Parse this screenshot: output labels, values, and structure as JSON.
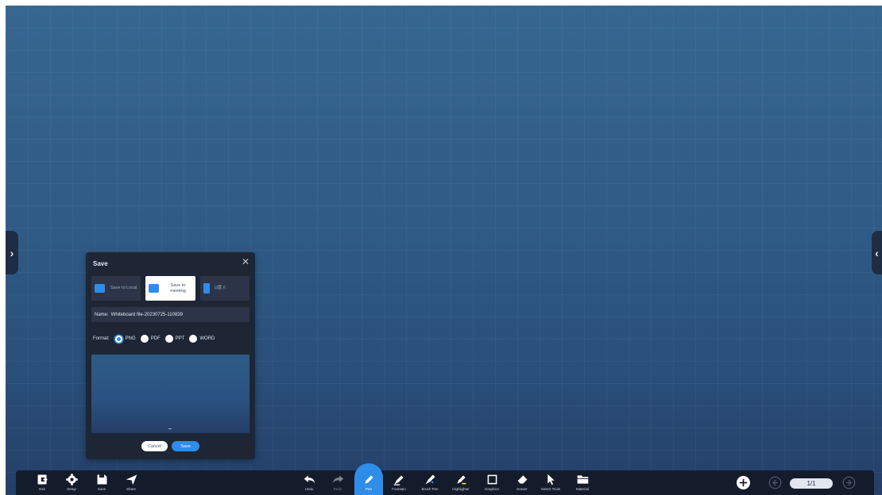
{
  "dialog": {
    "title": "Save",
    "destinations": [
      {
        "label": "Save to Local",
        "icon": "folder-icon",
        "active": false
      },
      {
        "label": "Save to meeting",
        "icon": "meeting-icon",
        "active": true
      },
      {
        "label": "U盘 /\\",
        "icon": "usb-drive-icon",
        "active": false
      }
    ],
    "name_label": "Name:",
    "name_value": "Whiteboard file-20230725-110839",
    "format_label": "Format:",
    "formats": [
      "PNG",
      "PDF",
      "PPT",
      "WORD"
    ],
    "selected_format": "PNG",
    "cancel_label": "Cancel",
    "save_label": "Save"
  },
  "toolbar": {
    "left_tools": [
      {
        "label": "Exit",
        "icon": "exit-icon"
      },
      {
        "label": "Setup",
        "icon": "gear-icon"
      },
      {
        "label": "Save",
        "icon": "save-icon"
      },
      {
        "label": "Share",
        "icon": "share-icon"
      }
    ],
    "center_tools": [
      {
        "label": "Undo",
        "icon": "undo-icon"
      },
      {
        "label": "Redo",
        "icon": "redo-icon"
      },
      {
        "label": "Pen",
        "icon": "pen-icon"
      },
      {
        "label": "Fountain",
        "icon": "fountain-pen-icon"
      },
      {
        "label": "Brush Pen",
        "icon": "brush-pen-icon"
      },
      {
        "label": "Highlighter",
        "icon": "highlighter-icon"
      },
      {
        "label": "Graphics",
        "icon": "square-icon"
      },
      {
        "label": "Eraser",
        "icon": "eraser-icon"
      },
      {
        "label": "Select Tools",
        "icon": "cursor-icon"
      },
      {
        "label": "Material",
        "icon": "folder-icon"
      }
    ],
    "active_tool": "Pen",
    "page_indicator": "1/1"
  },
  "colors": {
    "accent": "#2f8dea",
    "toolbar_bg": "#141c2b",
    "dialog_bg": "#1e2635",
    "canvas_top": "#366791",
    "canvas_bottom": "#243f68"
  }
}
